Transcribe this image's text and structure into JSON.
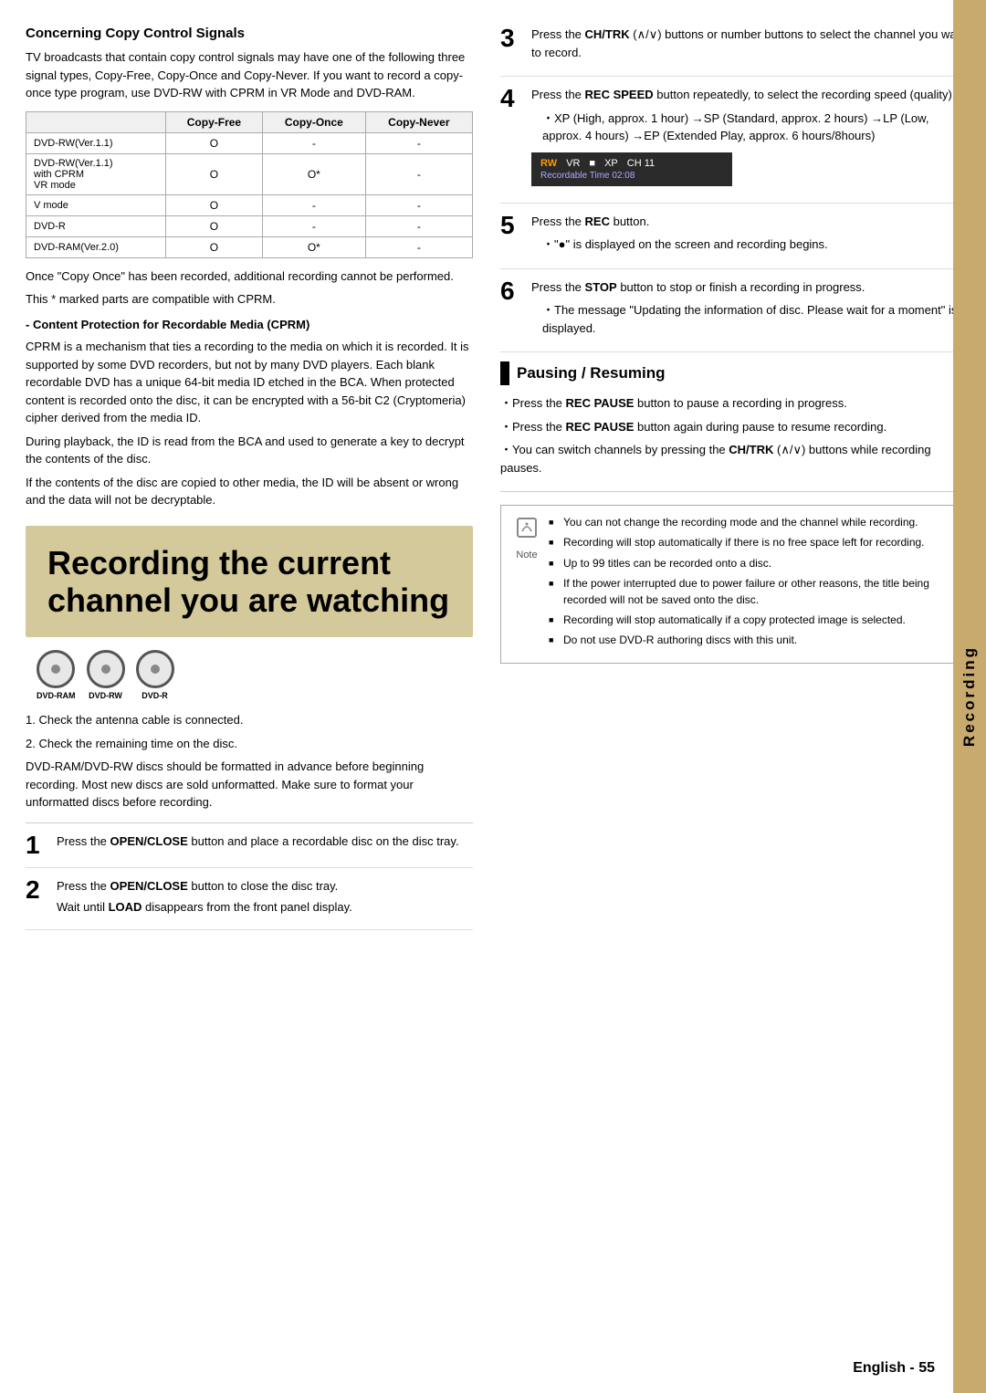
{
  "left": {
    "copy_section": {
      "title": "Concerning Copy Control Signals",
      "intro": "TV broadcasts that contain copy control signals may have one of the following three signal types, Copy-Free, Copy-Once and Copy-Never. If you want to record a copy-once type program, use DVD-RW with CPRM in VR Mode and DVD-RAM.",
      "table": {
        "headers": [
          "",
          "Copy-Free",
          "Copy-Once",
          "Copy-Never"
        ],
        "rows": [
          [
            "DVD-RW(Ver.1.1)",
            "O",
            "-",
            "-"
          ],
          [
            "DVD-RW(Ver.1.1)\nwith CPRM\nVR mode",
            "O",
            "O*",
            "-"
          ],
          [
            "V mode",
            "O",
            "-",
            "-"
          ],
          [
            "DVD-R",
            "O",
            "-",
            "-"
          ],
          [
            "DVD-RAM(Ver.2.0)",
            "O",
            "O*",
            "-"
          ]
        ]
      },
      "after_table_1": "Once \"Copy Once\" has been recorded, additional recording cannot be performed.",
      "after_table_2": "This * marked parts are compatible with CPRM.",
      "cprm_title": "- Content Protection for Recordable Media (CPRM)",
      "cprm_text": "CPRM is a mechanism that ties a recording to the media on which it is recorded. It is supported by some DVD recorders, but not by many DVD players. Each blank recordable DVD has a unique 64-bit media ID etched in the BCA. When protected content is recorded onto the disc, it can be encrypted with a 56-bit C2 (Cryptomeria) cipher derived from the media ID.\nDuring playback, the ID is read from the BCA and used to generate a key to decrypt the contents of the disc.\nIf the contents of the disc are copied to other media, the ID will be absent or wrong and the data will not be decryptable."
    },
    "hero": {
      "line1": "Recording the current",
      "line2": "channel you are watching"
    },
    "disc_icons": [
      {
        "label": "DVD-RAM"
      },
      {
        "label": "DVD-RW"
      },
      {
        "label": "DVD-R"
      }
    ],
    "pre_steps": [
      "1. Check the antenna cable is connected.",
      "2. Check the remaining time on the disc."
    ],
    "prep_text": "DVD-RAM/DVD-RW discs should be formatted in advance before beginning recording. Most new discs are sold unformatted. Make sure to format your unformatted discs before recording.",
    "steps": [
      {
        "num": "1",
        "text": "Press the ",
        "bold": "OPEN/CLOSE",
        "text2": " button and place a recordable disc on the disc tray."
      },
      {
        "num": "2",
        "main": "Press the ",
        "bold1": "OPEN/CLOSE",
        "main2": " button to close the disc tray.",
        "sub": "Wait until ",
        "bold2": "LOAD",
        "sub2": " disappears from the front panel display."
      }
    ]
  },
  "right": {
    "steps": [
      {
        "num": "3",
        "text": "Press the ",
        "bold1": "CH/TRK",
        "text2": " (∧/∨) buttons or number buttons to select the channel you want to record."
      },
      {
        "num": "4",
        "main": "Press the ",
        "bold1": "REC SPEED",
        "main2": " button repeatedly, to select the recording speed (quality).",
        "bullets": [
          "XP (High, approx. 1 hour) →SP (Standard, approx. 2 hours) →LP (Low, approx. 4 hours) →EP (Extended Play, approx. 6 hours/8hours)"
        ],
        "screen": {
          "top": [
            "RW",
            "VR",
            "■",
            "XP",
            "CH 11"
          ],
          "bottom": "Recordable Time 02:08"
        }
      },
      {
        "num": "5",
        "main": "Press the ",
        "bold1": "REC",
        "main2": " button.",
        "bullets": [
          "\"●\" is displayed on the screen and recording begins."
        ]
      },
      {
        "num": "6",
        "main": "Press the ",
        "bold1": "STOP",
        "main2": " button to stop or finish a recording in progress.",
        "bullets": [
          "The message \"Updating the information of disc. Please wait for a moment\" is displayed."
        ]
      }
    ],
    "pausing": {
      "title": "Pausing / Resuming",
      "bullets": [
        {
          "text": "Press the ",
          "bold": "REC PAUSE",
          "text2": " button to pause a recording in progress."
        },
        {
          "text": "Press the ",
          "bold": "REC PAUSE",
          "text2": " button again during pause to resume recording."
        },
        {
          "text": "You can switch channels by pressing the ",
          "bold": "CH/TRK",
          "text2": " (∧/∨) buttons while recording pauses."
        }
      ]
    },
    "notes": [
      "You can not change the recording mode and the channel while recording.",
      "Recording will stop automatically if there is no free space left for recording.",
      "Up to 99 titles can be recorded onto a disc.",
      "If the power interrupted due to power failure or other reasons, the title being recorded will not be saved onto the disc.",
      "Recording will stop automatically if a copy protected image is selected.",
      "Do not use DVD-R authoring discs with this unit."
    ]
  },
  "footer": {
    "text": "English - 55"
  },
  "side_tab": {
    "label": "Recording"
  }
}
